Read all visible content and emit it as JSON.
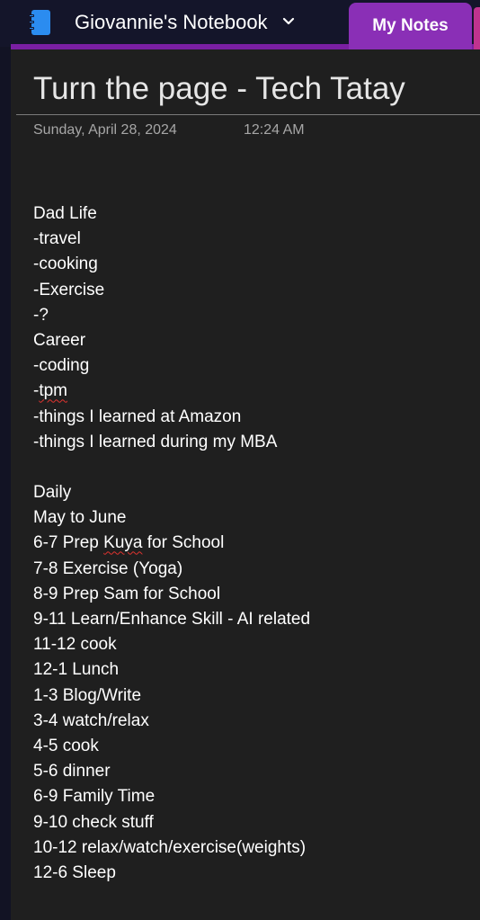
{
  "header": {
    "notebook_title": "Giovannie's Notebook",
    "icons": {
      "notebook": "notebook-icon",
      "chevron": "chevron-down-icon"
    },
    "active_tab_label": "My Notes"
  },
  "colors": {
    "tab_active": "#8a2fb6",
    "tab_strip": "#7a1fa3",
    "next_tab_edge": "#c0338e",
    "notebook_icon": "#2b8cf0",
    "page_background": "#1f1f1f",
    "spellcheck": "#e0332f"
  },
  "page": {
    "title": "Turn the page - Tech Tatay",
    "date": "Sunday, April 28, 2024",
    "time": "12:24 AM",
    "lines": [
      "Dad Life",
      "-travel",
      "-cooking",
      "-Exercise",
      "-?",
      "Career",
      "-coding",
      "-tpm",
      "-things I learned at Amazon",
      "-things I learned during my MBA",
      "",
      "Daily",
      "May to June",
      "6-7 Prep Kuya for School",
      "7-8 Exercise (Yoga)",
      "8-9 Prep Sam for School",
      "9-11 Learn/Enhance Skill - AI related",
      "11-12 cook",
      "12-1 Lunch",
      "1-3 Blog/Write",
      "3-4 watch/relax",
      "4-5 cook",
      "5-6 dinner",
      "6-9 Family Time",
      "9-10 check stuff",
      "10-12 relax/watch/exercise(weights)",
      "12-6 Sleep"
    ],
    "spellcheck_words": [
      "tpm",
      "Kuya"
    ]
  }
}
